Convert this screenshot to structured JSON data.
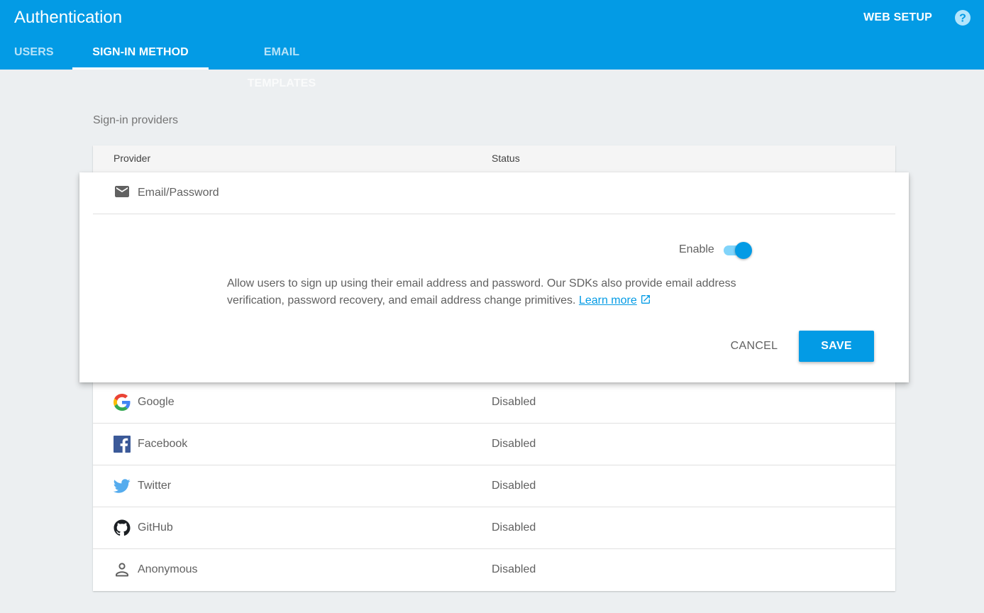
{
  "header": {
    "title": "Authentication",
    "web_setup_label": "WEB SETUP",
    "help_icon": "help-circle-icon",
    "background_color": "#039be5"
  },
  "tabs": [
    {
      "label": "USERS",
      "active": false
    },
    {
      "label": "SIGN-IN METHOD",
      "active": true
    },
    {
      "label": "EMAIL TEMPLATES",
      "active": false
    }
  ],
  "section": {
    "title": "Sign-in providers"
  },
  "table": {
    "columns": [
      "Provider",
      "Status"
    ],
    "expanded_provider": {
      "name": "Email/Password",
      "icon": "email-icon",
      "enable_label": "Enable",
      "enabled": true,
      "description": "Allow users to sign up using their email address and password. Our SDKs also provide email address verification, password recovery, and email address change primitives.",
      "learn_more_label": "Learn more",
      "cancel_label": "CANCEL",
      "save_label": "SAVE"
    },
    "rows": [
      {
        "name": "Google",
        "icon": "google-icon",
        "status": "Disabled"
      },
      {
        "name": "Facebook",
        "icon": "facebook-icon",
        "status": "Disabled"
      },
      {
        "name": "Twitter",
        "icon": "twitter-icon",
        "status": "Disabled"
      },
      {
        "name": "GitHub",
        "icon": "github-icon",
        "status": "Disabled"
      },
      {
        "name": "Anonymous",
        "icon": "person-icon",
        "status": "Disabled"
      }
    ]
  },
  "colors": {
    "accent": "#039be5",
    "toggle_track": "#81d4fa",
    "page_background": "#eceff1"
  }
}
